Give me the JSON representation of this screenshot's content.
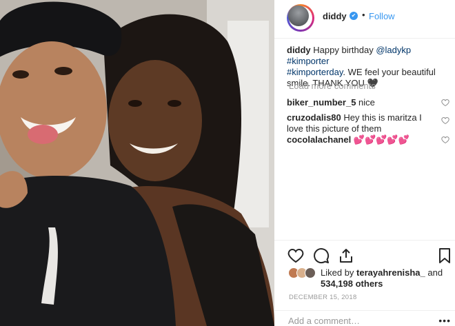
{
  "post": {
    "photo_alt": "",
    "header": {
      "username": "diddy",
      "verified_glyph": "✔",
      "separator": "•",
      "follow_label": "Follow"
    },
    "caption": {
      "username": "diddy",
      "text_1": " Happy birthday ",
      "mention": "@ladykp",
      "space": " ",
      "tag_1": "#kimporter",
      "tag_2": "#kimporterday",
      "text_2": ". WE feel your beautiful smile. THANK YOU ",
      "emoji": "🖤"
    },
    "load_more_label": "Load more comments",
    "comments": [
      {
        "username": "biker_number_5",
        "text": " nice"
      },
      {
        "username": "cruzodalis80",
        "text": " Hey this is maritza I love this picture of them"
      },
      {
        "username": "cocolalachanel",
        "text": " 💕💕💕💕💕"
      }
    ],
    "likes": {
      "prefix": "Liked by ",
      "user": "terayahrenisha_",
      "middle": " and ",
      "count": "534,198 others"
    },
    "date": "DECEMBER 15, 2018",
    "add_comment_placeholder": "Add a comment…",
    "more_glyph": "•••",
    "icons": [
      "heart-icon",
      "comment-icon",
      "share-icon",
      "bookmark-icon"
    ]
  },
  "colors": {
    "accent": "#3897f0",
    "text": "#262626",
    "muted": "#999999",
    "link": "#003569"
  }
}
